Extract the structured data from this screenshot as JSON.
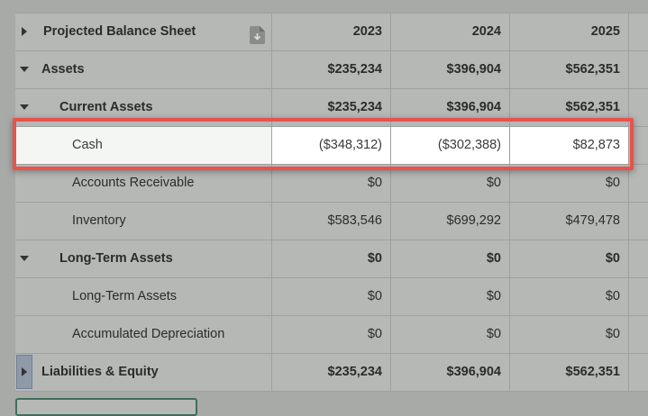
{
  "sheet": {
    "title": "Projected Balance Sheet",
    "years": [
      "2023",
      "2024",
      "2025"
    ],
    "rows": [
      {
        "label": "Assets",
        "values": [
          "$235,234",
          "$396,904",
          "$562,351"
        ]
      },
      {
        "label": "Current Assets",
        "values": [
          "$235,234",
          "$396,904",
          "$562,351"
        ]
      },
      {
        "label": "Cash",
        "values": [
          "($348,312)",
          "($302,388)",
          "$82,873"
        ]
      },
      {
        "label": "Accounts Receivable",
        "values": [
          "$0",
          "$0",
          "$0"
        ]
      },
      {
        "label": "Inventory",
        "values": [
          "$583,546",
          "$699,292",
          "$479,478"
        ]
      },
      {
        "label": "Long-Term Assets",
        "values": [
          "$0",
          "$0",
          "$0"
        ]
      },
      {
        "label": "Long-Term Assets",
        "values": [
          "$0",
          "$0",
          "$0"
        ]
      },
      {
        "label": "Accumulated Depreciation",
        "values": [
          "$0",
          "$0",
          "$0"
        ]
      },
      {
        "label": "Liabilities & Equity",
        "values": [
          "$235,234",
          "$396,904",
          "$562,351"
        ]
      }
    ]
  },
  "icons": {
    "header_toggle": "caret-right-icon",
    "export": "file-download-icon",
    "expanded": "caret-down-icon",
    "collapsed": "caret-right-icon"
  },
  "colors": {
    "highlight_border": "#e8524a",
    "overlay_bg": "#b6b8b6",
    "comment_marker": "#c9a34a"
  }
}
